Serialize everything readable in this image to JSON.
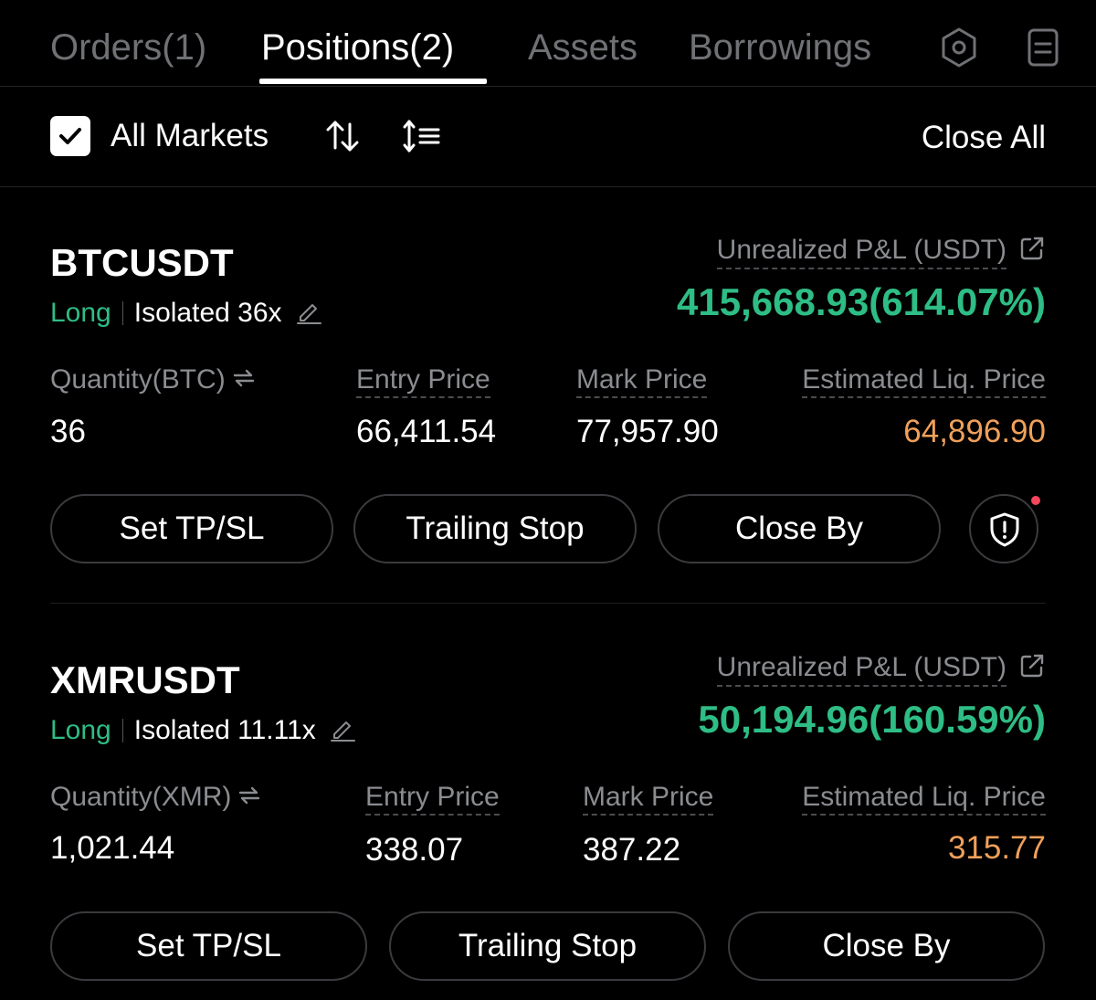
{
  "tabs": [
    {
      "label": "Orders(1)"
    },
    {
      "label": "Positions(2)"
    },
    {
      "label": "Assets"
    },
    {
      "label": "Borrowings"
    }
  ],
  "active_tab": "Positions(2)",
  "toolbar": {
    "all_markets_label": "All Markets",
    "all_markets_checked": true,
    "close_all_label": "Close All"
  },
  "positions": [
    {
      "symbol": "BTCUSDT",
      "side": "Long",
      "margin": "Isolated 36x",
      "pnl_label": "Unrealized P&L (USDT)",
      "pnl_value": "415,668.93(614.07%)",
      "quantity_label": "Quantity(BTC)",
      "quantity": "36",
      "entry_label": "Entry Price",
      "entry": "66,411.54",
      "mark_label": "Mark Price",
      "mark": "77,957.90",
      "liq_label": "Estimated Liq. Price",
      "liq": "64,896.90",
      "buttons": {
        "tpsl": "Set TP/SL",
        "trailing": "Trailing Stop",
        "close_by": "Close By"
      }
    },
    {
      "symbol": "XMRUSDT",
      "side": "Long",
      "margin": "Isolated 11.11x",
      "pnl_label": "Unrealized P&L (USDT)",
      "pnl_value": "50,194.96(160.59%)",
      "quantity_label": "Quantity(XMR)",
      "quantity": "1,021.44",
      "entry_label": "Entry Price",
      "entry": "338.07",
      "mark_label": "Mark Price",
      "mark": "387.22",
      "liq_label": "Estimated Liq. Price",
      "liq": "315.77",
      "buttons": {
        "tpsl": "Set TP/SL",
        "trailing": "Trailing Stop",
        "close_by": "Close By"
      }
    }
  ],
  "colors": {
    "background": "#000000",
    "profit_green": "#2ebd85",
    "liq_orange": "#f0a05a",
    "muted_text": "#8a8c90",
    "notification_red": "#f6465d"
  },
  "icons": [
    "shield-settings-icon",
    "document-icon",
    "checkmark-icon",
    "sort-arrows-icon",
    "filter-list-icon",
    "edit-pencil-icon",
    "external-link-icon",
    "swap-icon",
    "shield-alert-icon"
  ]
}
